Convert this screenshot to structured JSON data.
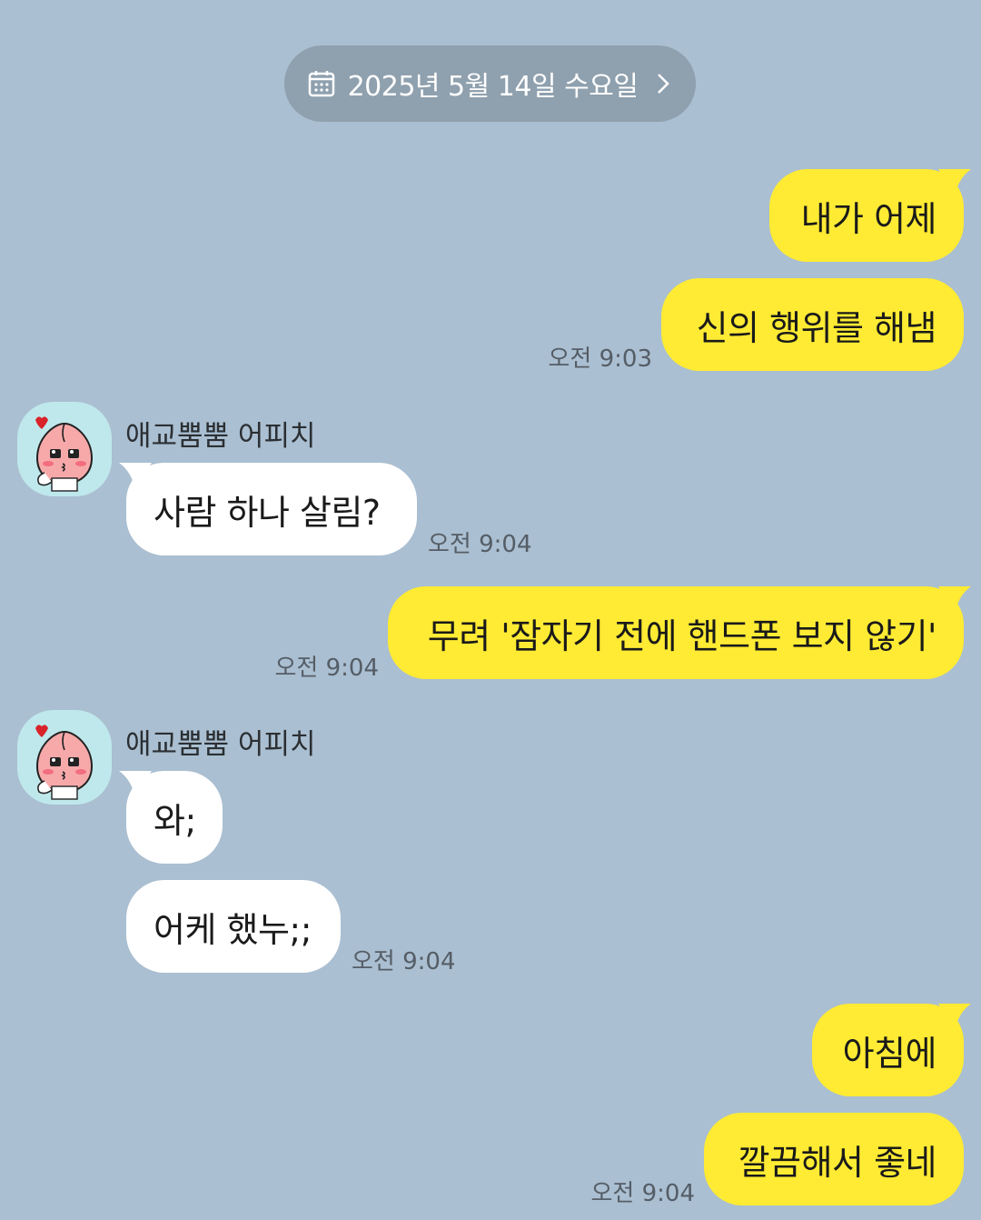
{
  "date_divider": {
    "label": "2025년 5월 14일 수요일"
  },
  "sender_name": "애교뿜뿜 어피치",
  "messages": {
    "m1": {
      "text": "내가 어제"
    },
    "m2": {
      "text": "신의 행위를 해냄",
      "time": "오전 9:03"
    },
    "m3": {
      "text": "사람 하나 살림?",
      "time": "오전 9:04"
    },
    "m4": {
      "text": "무려 '잠자기 전에 핸드폰 보지 않기'",
      "time": "오전 9:04"
    },
    "m5": {
      "text": "와;"
    },
    "m6": {
      "text": "어케 했누;;",
      "time": "오전 9:04"
    },
    "m7": {
      "text": "아침에"
    },
    "m8": {
      "text": "깔끔해서 좋네",
      "time": "오전 9:04"
    }
  },
  "colors": {
    "background": "#aabfd1",
    "my_bubble": "#ffeb33",
    "their_bubble": "#ffffff",
    "date_pill": "#8fa0ae"
  }
}
